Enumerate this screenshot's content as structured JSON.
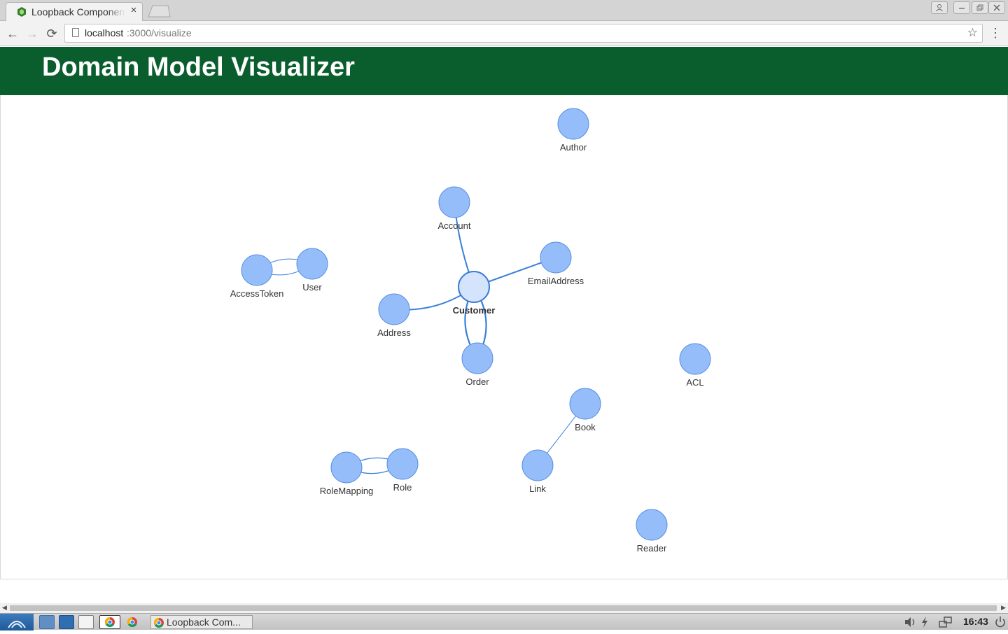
{
  "browser": {
    "tab": {
      "title": "Loopback Components",
      "close_glyph": "×"
    },
    "address": {
      "host": "localhost",
      "path": ":3000/visualize"
    },
    "nav": {
      "back_glyph": "←",
      "forward_glyph": "→",
      "reload_glyph": "⟳",
      "star_glyph": "☆",
      "menu_glyph": "⋮"
    }
  },
  "page": {
    "title": "Domain Model Visualizer"
  },
  "graph": {
    "colors": {
      "node_fill": "#94bdfa",
      "node_stroke": "#5a8fe0",
      "focus_fill": "#d3e4fc",
      "focus_stroke": "#3c7bd8",
      "link": "#3a7fd8",
      "label": "#333333"
    },
    "focus_node": "Customer",
    "nodes": [
      "Author",
      "Account",
      "EmailAddress",
      "Customer",
      "Address",
      "Order",
      "AccessToken",
      "User",
      "ACL",
      "Book",
      "Link",
      "RoleMapping",
      "Role",
      "Reader"
    ],
    "links": [
      [
        "Account",
        "Customer"
      ],
      [
        "EmailAddress",
        "Customer"
      ],
      [
        "Address",
        "Customer"
      ],
      [
        "Customer",
        "Order"
      ],
      [
        "Order",
        "Customer"
      ],
      [
        "AccessToken",
        "User"
      ],
      [
        "User",
        "AccessToken"
      ],
      [
        "Book",
        "Link"
      ],
      [
        "RoleMapping",
        "Role"
      ],
      [
        "Role",
        "RoleMapping"
      ]
    ]
  },
  "taskbar": {
    "task_label": "Loopback Com...",
    "clock": "16:43"
  }
}
